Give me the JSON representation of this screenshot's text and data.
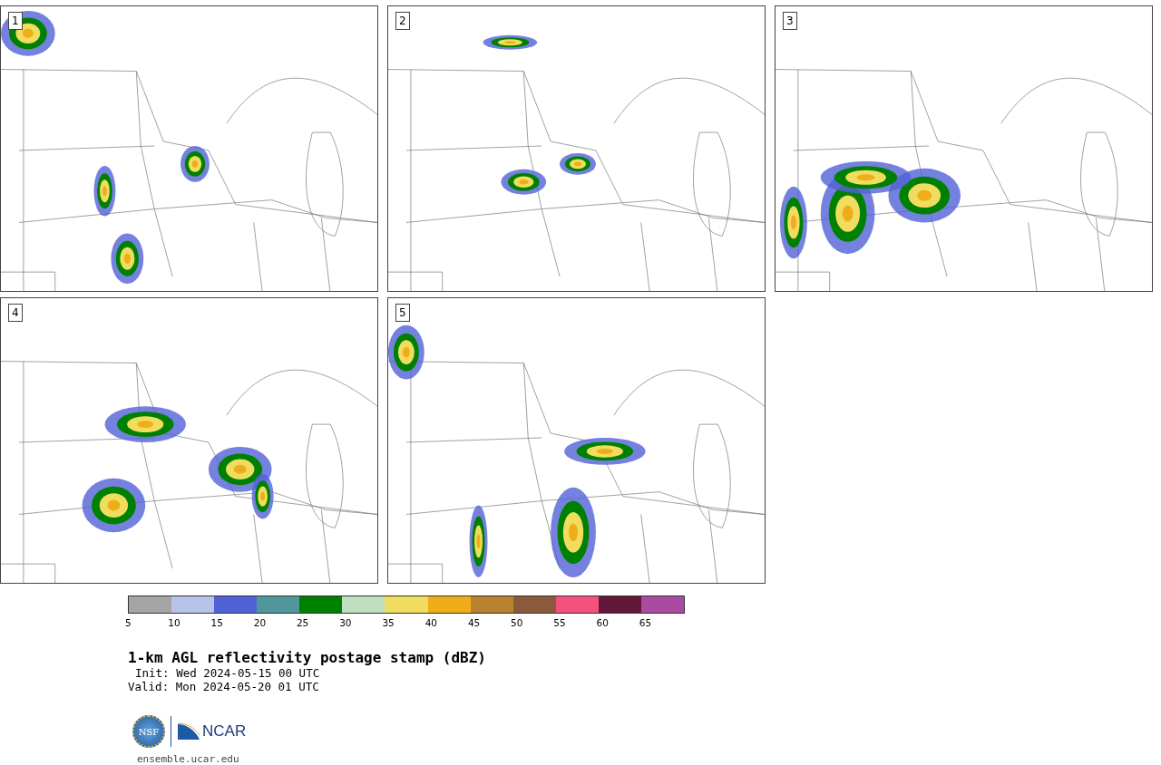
{
  "panels": [
    {
      "label": "1"
    },
    {
      "label": "2"
    },
    {
      "label": "3"
    },
    {
      "label": "4"
    },
    {
      "label": "5"
    }
  ],
  "colorbar": {
    "bins": [
      {
        "color": "#a5a5a5",
        "tick": "5"
      },
      {
        "color": "#b8c3ec",
        "tick": "10"
      },
      {
        "color": "#5161d6",
        "tick": "15"
      },
      {
        "color": "#4f979b",
        "tick": "20"
      },
      {
        "color": "#008000",
        "tick": "25"
      },
      {
        "color": "#bfdfbf",
        "tick": "30"
      },
      {
        "color": "#f0dc5e",
        "tick": "35"
      },
      {
        "color": "#efae19",
        "tick": "40"
      },
      {
        "color": "#b9822f",
        "tick": "45"
      },
      {
        "color": "#8b5a3c",
        "tick": "50"
      },
      {
        "color": "#f4527c",
        "tick": "55"
      },
      {
        "color": "#621738",
        "tick": "60"
      },
      {
        "color": "#aa4aa0",
        "tick": "65"
      }
    ]
  },
  "title": "1-km AGL reflectivity postage stamp (dBZ)",
  "init": "Init: Wed 2024-05-15 00 UTC",
  "valid": "Valid: Mon 2024-05-20 01 UTC",
  "logo": {
    "nsf": "NSF",
    "ncar": "NCAR"
  },
  "url": "ensemble.ucar.edu"
}
